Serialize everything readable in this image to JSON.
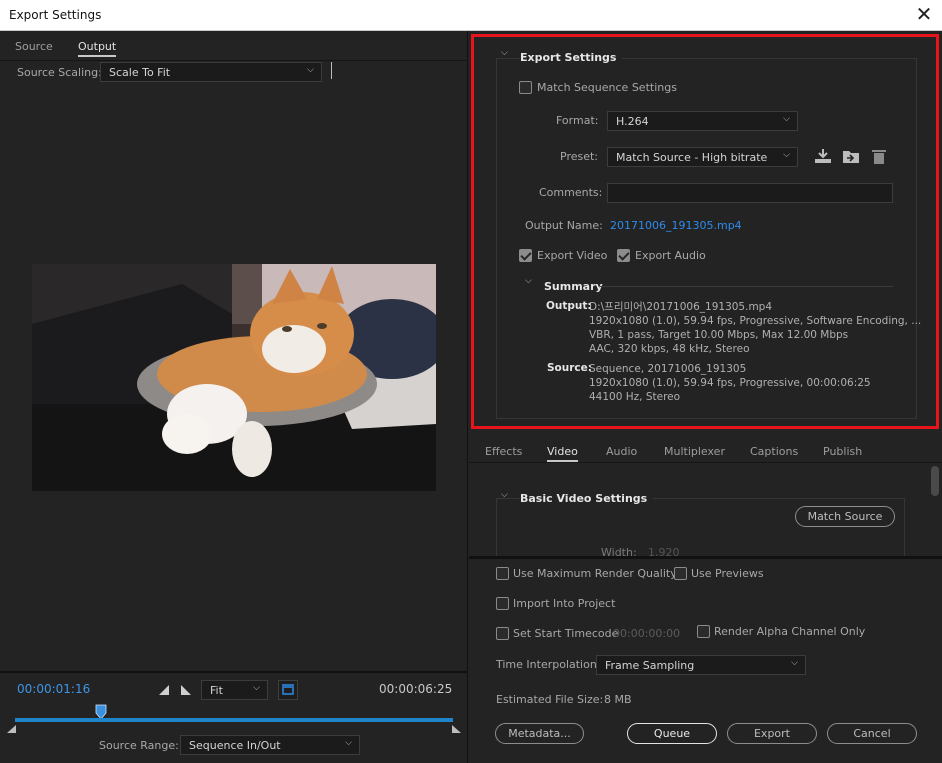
{
  "window": {
    "title": "Export Settings"
  },
  "left": {
    "tabs": [
      "Source",
      "Output"
    ],
    "active_tab": "Output",
    "scaling_label": "Source Scaling:",
    "scaling_value": "Scale To Fit",
    "timecode_current": "00:00:01:16",
    "fit_value": "Fit",
    "timecode_end": "00:00:06:25",
    "range_label": "Source Range:",
    "range_value": "Sequence In/Out"
  },
  "export_settings": {
    "title": "Export Settings",
    "match_sequence": "Match Sequence Settings",
    "format_label": "Format:",
    "format_value": "H.264",
    "preset_label": "Preset:",
    "preset_value": "Match Source - High bitrate",
    "comments_label": "Comments:",
    "comments_value": "",
    "output_name_label": "Output Name:",
    "output_name_value": "20171006_191305.mp4",
    "export_video": "Export Video",
    "export_audio": "Export Audio",
    "summary_title": "Summary",
    "output_label": "Output:",
    "output_lines": [
      "D:\\프리미어\\20171006_191305.mp4",
      "1920x1080 (1.0), 59.94 fps, Progressive, Software Encoding, ...",
      "VBR, 1 pass, Target 10.00 Mbps, Max 12.00 Mbps",
      "AAC, 320 kbps, 48 kHz, Stereo"
    ],
    "source_label": "Source:",
    "source_lines": [
      "Sequence, 20171006_191305",
      "1920x1080 (1.0), 59.94 fps, Progressive, 00:00:06:25",
      "44100 Hz, Stereo"
    ]
  },
  "settings_tabs": {
    "items": [
      "Effects",
      "Video",
      "Audio",
      "Multiplexer",
      "Captions",
      "Publish"
    ],
    "active": "Video"
  },
  "video": {
    "section_title": "Basic Video Settings",
    "match_source": "Match Source",
    "width_label": "Width:",
    "width_value": "1,920"
  },
  "bottom": {
    "max_render": "Use Maximum Render Quality",
    "use_previews": "Use Previews",
    "import_project": "Import Into Project",
    "set_start_tc": "Set Start Timecode",
    "start_tc_value": "00:00:00:00",
    "render_alpha": "Render Alpha Channel Only",
    "time_interp_label": "Time Interpolation:",
    "time_interp_value": "Frame Sampling",
    "file_size_label": "Estimated File Size:",
    "file_size_value": "8 MB",
    "metadata": "Metadata...",
    "queue": "Queue",
    "export": "Export",
    "cancel": "Cancel"
  },
  "colors": {
    "accent": "#2d8ceb",
    "highlight": "#e8141b",
    "timeline": "#1e86c8"
  },
  "icons": [
    "close-icon",
    "chevron-down-icon",
    "save-preset-icon",
    "import-preset-icon",
    "delete-preset-icon",
    "mark-in-icon",
    "mark-out-icon",
    "safe-margins-icon",
    "playhead-icon"
  ]
}
